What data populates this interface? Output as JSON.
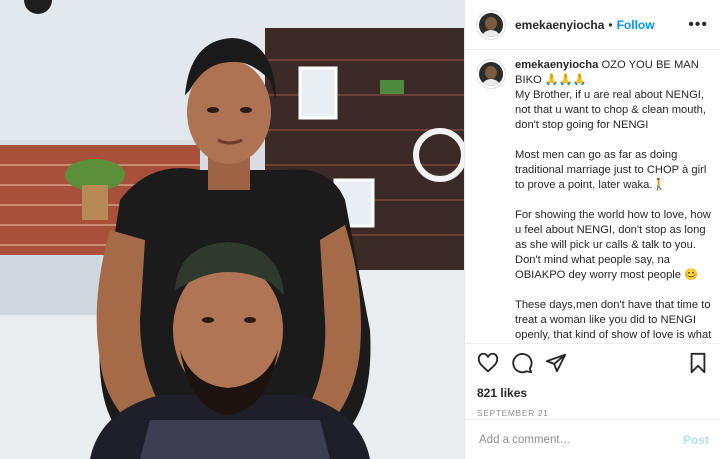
{
  "post": {
    "username": "emekaenyiocha",
    "follow_label": "Follow",
    "separator": "•",
    "more_icon": "more-options-icon",
    "caption": {
      "username": "emekaenyiocha",
      "first_line": "OZO YOU BE MAN BIKO 🙏🙏🙏",
      "paragraphs": [
        "My Brother, if u are real about NENGI, not that u want to chop & clean mouth, don't stop going for NENGI",
        "Most men can go as far as doing traditional marriage just to CHOP à girl to prove a point, later waka.🚶",
        "For showing the world how to love, how u feel about NENGI, don't stop as long as she will pick ur calls & talk to you. Don't mind what people say, na OBIAKPO dey worry most people 😊",
        "These days,men don't have that time to treat a woman like you did to NENGI openly, that kind of show of love is what majority of women wish for"
      ]
    },
    "likes": "821 likes",
    "date": "SEPTEMBER 21",
    "comment_placeholder": "Add a comment…",
    "post_label": "Post",
    "icons": [
      "heart-icon",
      "comment-icon",
      "share-icon",
      "bookmark-icon"
    ]
  }
}
